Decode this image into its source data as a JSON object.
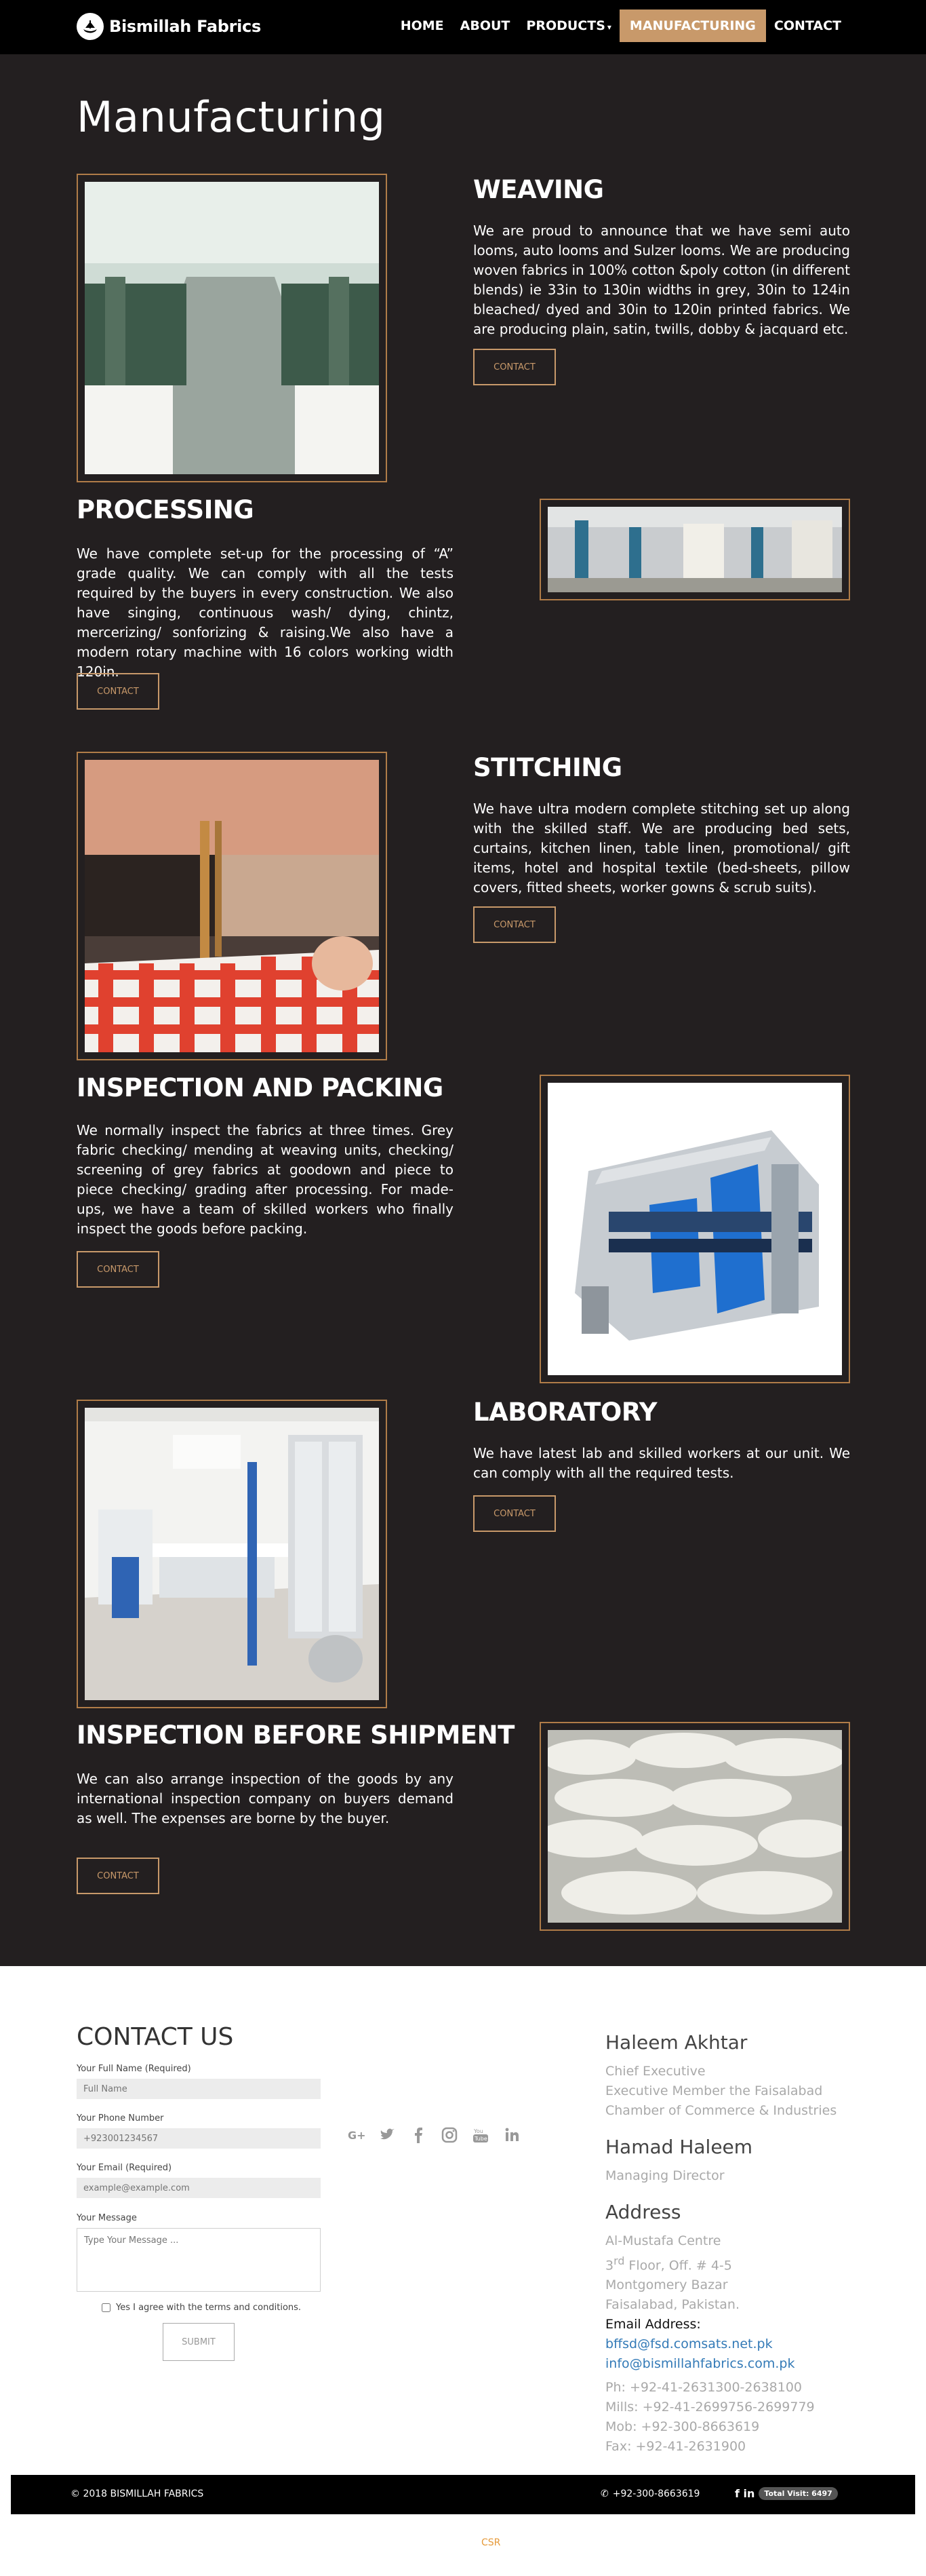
{
  "nav": {
    "brand": "Bismillah Fabrics",
    "items": [
      {
        "label": "HOME"
      },
      {
        "label": "ABOUT"
      },
      {
        "label": "PRODUCTS"
      },
      {
        "label": "MANUFACTURING"
      },
      {
        "label": "CONTACT"
      }
    ],
    "active_color": "#c8996a"
  },
  "page": {
    "title": "Manufacturing"
  },
  "sections": [
    {
      "title": "WEAVING",
      "text": "We are proud to announce that we have semi auto looms, auto looms and Sulzer looms. We are producing woven fabrics in 100% cotton &poly cotton (in different blends) ie 33in to 130in widths in grey, 30in to 124in bleached/ dyed and 30in to 120in printed fabrics. We are producing plain, satin, twills, dobby & jacquard etc.",
      "button": "CONTACT",
      "image": "weaving-looms-photo"
    },
    {
      "title": "PROCESSING",
      "text": "We have complete set-up for the processing of “A” grade quality. We can comply with all the tests required by the buyers in every construction. We also have singing, continuous wash/ dying, chintz, mercerizing/ sonforizing & raising.We also have a modern rotary machine with 16 colors working width 120in.",
      "button": "CONTACT",
      "image": "processing-plant-photo"
    },
    {
      "title": "STITCHING",
      "text": "We have ultra modern complete stitching set up along with the skilled staff. We are producing bed sets, curtains, kitchen linen, table linen, promotional/ gift items, hotel and hospital textile (bed-sheets, pillow covers, fitted sheets, worker gowns & scrub suits).",
      "button": "CONTACT",
      "image": "sewing-machine-photo"
    },
    {
      "title": "INSPECTION AND PACKING",
      "text": "We normally inspect the fabrics at three times. Grey fabric checking/ mending at weaving units, checking/ screening of grey fabrics at goodown and piece to piece checking/ grading after processing. For made-ups, we have a team of skilled workers who finally inspect the goods before packing.",
      "button": "CONTACT",
      "image": "inspection-machine-photo"
    },
    {
      "title": "LABORATORY",
      "text": "We have latest lab and skilled workers at our unit. We can comply with all the required tests.",
      "button": "CONTACT",
      "image": "laboratory-photo"
    },
    {
      "title": "INSPECTION BEFORE SHIPMENT",
      "text": "We can also arrange inspection of the goods by any international inspection company on buyers demand as well. The expenses are borne by the buyer.",
      "button": "CONTACT",
      "image": "fabric-rolls-photo"
    }
  ],
  "contact_form": {
    "title": "CONTACT US",
    "name_label": "Your Full Name (Required)",
    "name_placeholder": "Full Name",
    "phone_label": "Your Phone Number",
    "phone_placeholder": "+923001234567",
    "email_label": "Your Email (Required)",
    "email_placeholder": "example@example.com",
    "message_label": "Your Message",
    "message_placeholder": "Type Your Message ...",
    "agree_label": "Yes I agree with the terms and conditions.",
    "submit": "SUBMIT"
  },
  "socials": [
    "google-plus-icon",
    "twitter-icon",
    "facebook-icon",
    "instagram-icon",
    "youtube-icon",
    "linkedin-icon"
  ],
  "contacts": {
    "person1_name": "Haleem Akhtar",
    "person1_role1": "Chief Executive",
    "person1_role2": "Executive Member the Faisalabad",
    "person1_role3": "Chamber of Commerce & Industries",
    "person2_name": "Hamad Haleem",
    "person2_role": "Managing Director",
    "address_title": "Address",
    "address1": "Al-Mustafa Centre",
    "address2_floor_num": "3",
    "address2_sup": "rd",
    "address2_rest": " Floor, Off. # 4-5",
    "address3": "Montgomery Bazar",
    "address4": "Faisalabad, Pakistan.",
    "email_title": "Email Address:",
    "email1": "bffsd@fsd.comsats.net.pk",
    "email2": "info@bismillahfabrics.com.pk",
    "phone": "Ph: +92-41-2631300-2638100",
    "mills": "Mills: +92-41-2699756-2699779",
    "mob": "Mob: +92-300-8663619",
    "fax": "Fax: +92-41-2631900"
  },
  "footer": {
    "copyright": "© 2018 BISMILLAH FABRICS",
    "phone": "+92-300-8663619",
    "social": "f in",
    "visits": "Total Visit: 6497",
    "csr": "CSR"
  }
}
